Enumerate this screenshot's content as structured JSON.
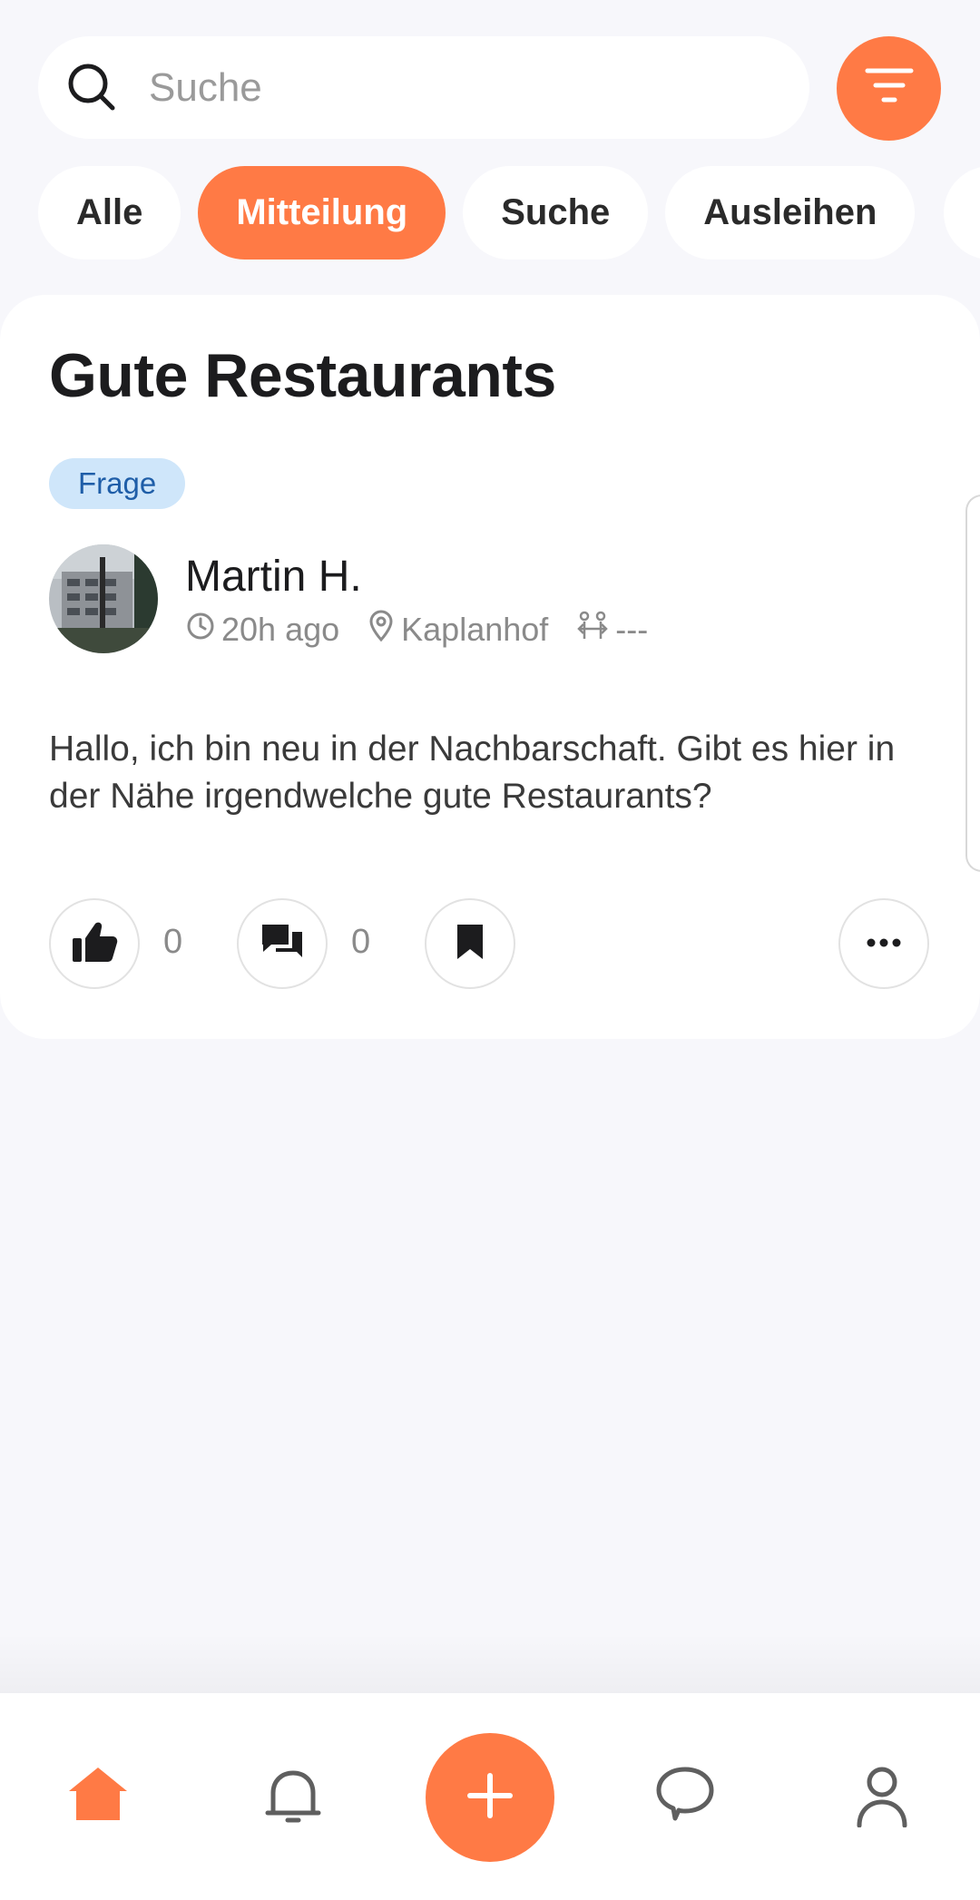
{
  "search": {
    "placeholder": "Suche"
  },
  "categories": [
    {
      "label": "Alle",
      "active": false
    },
    {
      "label": "Mitteilung",
      "active": true
    },
    {
      "label": "Suche",
      "active": false
    },
    {
      "label": "Ausleihen",
      "active": false
    }
  ],
  "post": {
    "title": "Gute Restaurants",
    "tag": "Frage",
    "author": "Martin H.",
    "time": "20h ago",
    "location": "Kaplanhof",
    "distance": "---",
    "body": "Hallo, ich bin neu in der Nachbarschaft. Gibt es hier in der Nähe irgendwelche gute Restaurants?",
    "likes": "0",
    "comments": "0"
  },
  "icons": {
    "search": "search-icon",
    "filter": "filter-icon",
    "clock": "clock-icon",
    "location": "location-pin-icon",
    "distance": "distance-arrows-icon",
    "like": "thumbs-up-icon",
    "comment": "chat-bubbles-icon",
    "bookmark": "bookmark-icon",
    "more": "more-dots-icon",
    "home": "home-icon",
    "notifications": "bell-icon",
    "create": "plus-icon",
    "messages": "chat-bubble-icon",
    "profile": "person-icon"
  },
  "colors": {
    "accent": "#ff7a45",
    "background": "#f7f7fb",
    "tag_bg": "#cfe6fa",
    "tag_text": "#1f5ea8"
  }
}
